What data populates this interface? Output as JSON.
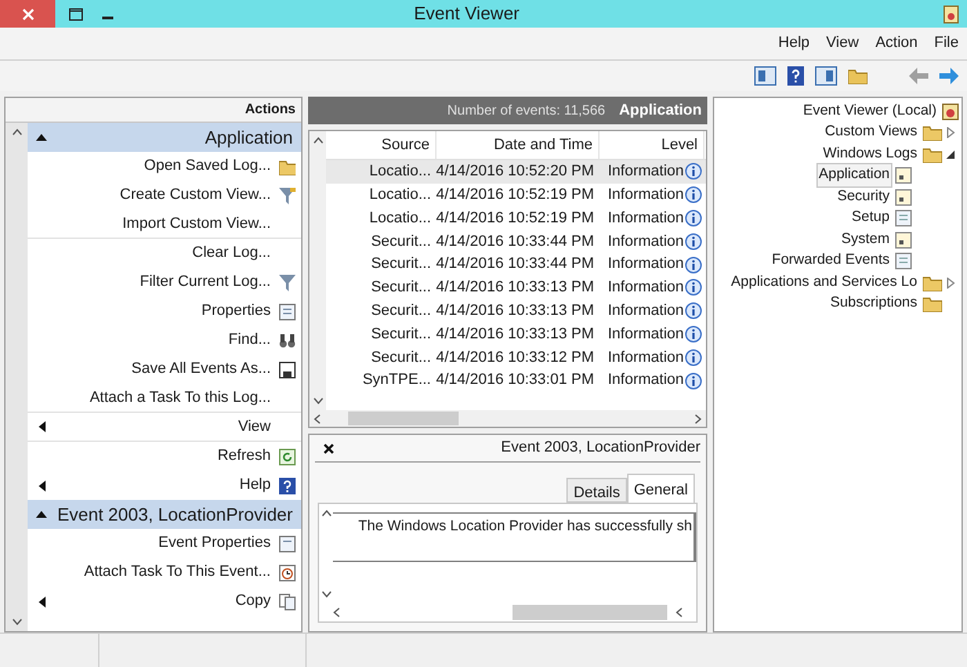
{
  "window": {
    "title": "Event Viewer"
  },
  "menu": [
    "Help",
    "View",
    "Action",
    "File"
  ],
  "tree": [
    {
      "label": "Event Viewer (Local)",
      "selected": false,
      "children": [
        {
          "label": "Custom Views",
          "selected": false,
          "expanded": false
        },
        {
          "label": "Windows Logs",
          "selected": false,
          "expanded": true,
          "children": [
            {
              "label": "Application",
              "selected": true
            },
            {
              "label": "Security",
              "selected": false
            },
            {
              "label": "Setup",
              "selected": false
            },
            {
              "label": "System",
              "selected": false
            },
            {
              "label": "Forwarded Events",
              "selected": false
            }
          ]
        },
        {
          "label": "Applications and Services Lo",
          "selected": false,
          "expanded": false
        },
        {
          "label": "Subscriptions",
          "selected": false
        }
      ]
    }
  ],
  "events": {
    "title": "Application",
    "count": "Number of events: 11,566",
    "columns": [
      "Source",
      "Date and Time",
      "Level"
    ],
    "rows": [
      {
        "source": "Locatio...",
        "date": "4/14/2016 10:52:20 PM",
        "level": "Information",
        "selected": true
      },
      {
        "source": "Locatio...",
        "date": "4/14/2016 10:52:19 PM",
        "level": "Information",
        "selected": false
      },
      {
        "source": "Locatio...",
        "date": "4/14/2016 10:52:19 PM",
        "level": "Information",
        "selected": false
      },
      {
        "source": "Securit...",
        "date": "4/14/2016 10:33:44 PM",
        "level": "Information",
        "selected": false
      },
      {
        "source": "Securit...",
        "date": "4/14/2016 10:33:44 PM",
        "level": "Information",
        "selected": false
      },
      {
        "source": "Securit...",
        "date": "4/14/2016 10:33:13 PM",
        "level": "Information",
        "selected": false
      },
      {
        "source": "Securit...",
        "date": "4/14/2016 10:33:13 PM",
        "level": "Information",
        "selected": false
      },
      {
        "source": "Securit...",
        "date": "4/14/2016 10:33:13 PM",
        "level": "Information",
        "selected": false
      },
      {
        "source": "Securit...",
        "date": "4/14/2016 10:33:12 PM",
        "level": "Information",
        "selected": false
      },
      {
        "source": "SynTPE...",
        "date": "4/14/2016 10:33:01 PM",
        "level": "Information",
        "selected": false
      }
    ]
  },
  "details": {
    "title": "Event 2003, LocationProvider",
    "tabs": [
      {
        "label": "Details",
        "selected": false
      },
      {
        "label": "General",
        "selected": true
      }
    ],
    "message": "The Windows Location Provider has successfully sh"
  },
  "actions": {
    "title": "Actions",
    "sections": [
      {
        "title": "Application",
        "expanded": true,
        "items": [
          {
            "label": "Open Saved Log...",
            "submenu": false,
            "divider_after": false
          },
          {
            "label": "Create Custom View...",
            "submenu": false,
            "divider_after": false
          },
          {
            "label": "Import Custom View...",
            "submenu": false,
            "divider_after": true
          },
          {
            "label": "Clear Log...",
            "submenu": false,
            "divider_after": false
          },
          {
            "label": "Filter Current Log...",
            "submenu": false,
            "divider_after": false
          },
          {
            "label": "Properties",
            "submenu": false,
            "divider_after": false
          },
          {
            "label": "Find...",
            "submenu": false,
            "divider_after": false
          },
          {
            "label": "Save All Events As...",
            "submenu": false,
            "divider_after": false
          },
          {
            "label": "Attach a Task To this Log...",
            "submenu": false,
            "divider_after": true
          },
          {
            "label": "View",
            "submenu": true,
            "divider_after": true
          },
          {
            "label": "Refresh",
            "submenu": false,
            "divider_after": false
          },
          {
            "label": "Help",
            "submenu": true,
            "divider_after": false
          }
        ]
      },
      {
        "title": "Event 2003, LocationProvider",
        "expanded": true,
        "items": [
          {
            "label": "Event Properties",
            "submenu": false,
            "divider_after": false
          },
          {
            "label": "Attach Task To This Event...",
            "submenu": false,
            "divider_after": false
          },
          {
            "label": "Copy",
            "submenu": true,
            "divider_after": false
          }
        ]
      }
    ]
  }
}
